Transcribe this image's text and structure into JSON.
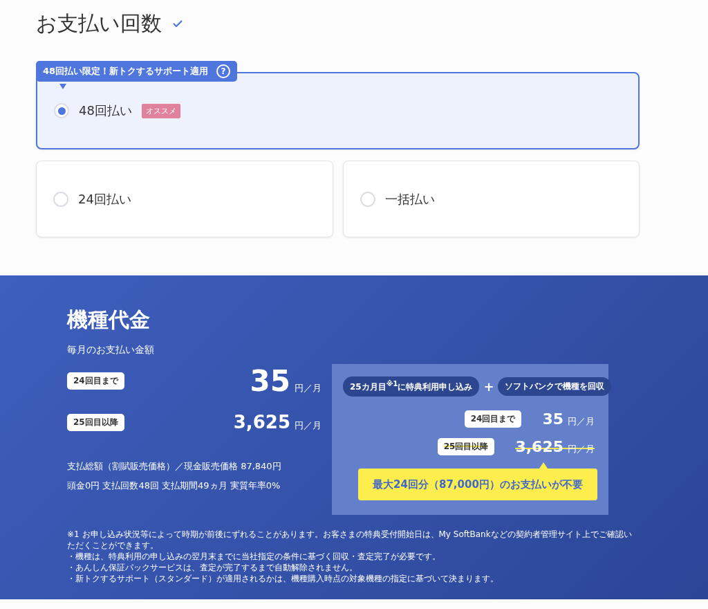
{
  "title": "お支払い回数",
  "promo": {
    "text": "48回払い限定！新トクするサポート適用",
    "help": "?"
  },
  "options": [
    {
      "kind": "featured",
      "label": "48回払い",
      "badge": "オススメ",
      "selected": true
    },
    {
      "kind": "standard",
      "label": "24回払い",
      "selected": false
    },
    {
      "kind": "standard",
      "label": "一括払い",
      "selected": false
    }
  ],
  "price": {
    "heading": "機種代金",
    "subheading": "毎月のお支払い金額",
    "rows": [
      {
        "kind": "lead",
        "tag": "24回目まで",
        "amount": "35",
        "unit": "円／月"
      },
      {
        "kind": "later",
        "tag": "25回目以降",
        "amount": "3,625",
        "unit": "円／月"
      }
    ],
    "notes": [
      "支払総額（割賦販売価格）／現金販売価格 87,840円",
      "頭金0円 支払回数48回 支払期間49ヵ月 実質年率0%"
    ]
  },
  "benefit": {
    "steps": [
      "25カ月目$^{※1}$に特典利用申し込み",
      "ソフトバンクで機種を回収"
    ],
    "joiner": "+",
    "rows": [
      {
        "tag": "24回目まで",
        "amount": "35",
        "unit": "円／月",
        "struck": false
      },
      {
        "tag": "25回目以降",
        "amount": "3,625",
        "unit": "円／月",
        "struck": true
      }
    ],
    "callout": "最大24回分（87,000円）のお支払いが不要"
  },
  "footnotes": [
    "※1 お申し込み状況等によって時期が前後にずれることがあります。お客さまの特典受付開始日は、My SoftBankなどの契約者管理サイト上でご確認いただくことができます。",
    "・機種は、特典利用の申し込みの翌月末までに当社指定の条件に基づく回収・査定完了が必要です。",
    "・あんしん保証パックサービスは、査定が完了するまで自動解除されません。",
    "・新トクするサポート（スタンダード）が適用されるかは、機種購入時点の対象機種の指定に基づいて決まります。"
  ]
}
